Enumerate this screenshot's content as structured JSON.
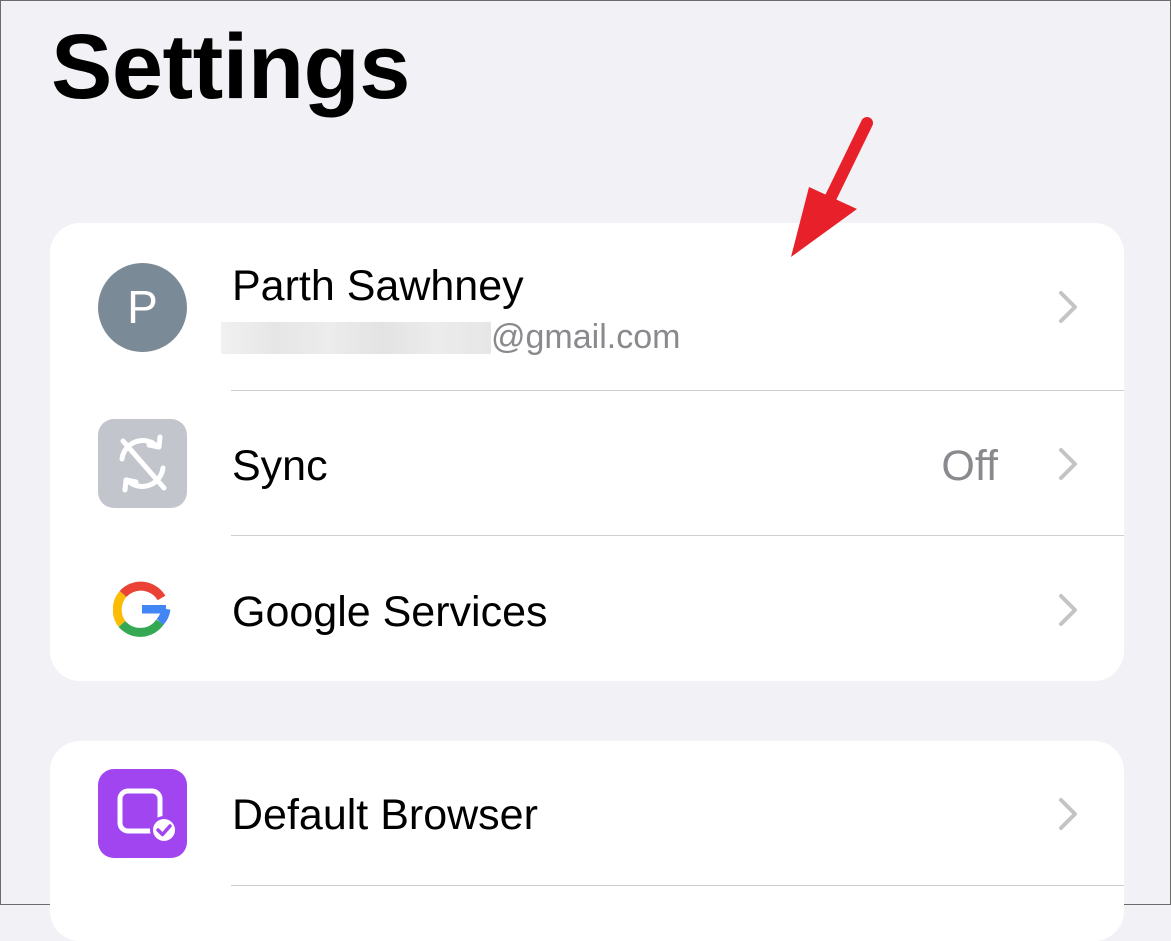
{
  "page": {
    "title": "Settings"
  },
  "account": {
    "initial": "P",
    "name": "Parth Sawhney",
    "email_visible": "@gmail.com"
  },
  "rows": {
    "sync": {
      "label": "Sync",
      "value": "Off",
      "icon": "sync-off-icon"
    },
    "google_services": {
      "label": "Google Services",
      "icon": "google-g-icon"
    },
    "default_browser": {
      "label": "Default Browser",
      "icon": "default-browser-icon"
    }
  },
  "colors": {
    "background": "#f2f2f6",
    "card": "#ffffff",
    "avatar": "#7b8a97",
    "sync_tile": "#c2c6cc",
    "browser_tile": "#a045f0",
    "annotation_arrow": "#e8202a",
    "chevron": "#c4c4c7"
  },
  "annotation": {
    "icon": "red-arrow-pointer"
  }
}
